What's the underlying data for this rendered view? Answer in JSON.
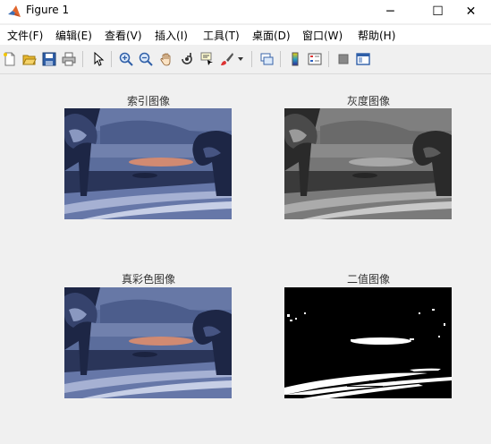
{
  "window": {
    "title": "Figure 1",
    "minimize_glyph": "─",
    "maximize_glyph": "☐",
    "close_glyph": "✕"
  },
  "menu": [
    {
      "label": "文件(F)"
    },
    {
      "label": "编辑(E)"
    },
    {
      "label": "查看(V)"
    },
    {
      "label": "插入(I)"
    },
    {
      "label": "工具(T)"
    },
    {
      "label": "桌面(D)"
    },
    {
      "label": "窗口(W)"
    },
    {
      "label": "帮助(H)"
    }
  ],
  "toolbar": {
    "icons": [
      "new-figure-icon",
      "open-file-icon",
      "save-icon",
      "print-icon",
      "pointer-icon",
      "zoom-in-icon",
      "zoom-out-icon",
      "pan-hand-icon",
      "rotate-3d-icon",
      "data-cursor-icon",
      "brush-icon",
      "link-plot-icon",
      "colorbar-icon",
      "legend-icon",
      "hide-plot-tools-icon",
      "show-plot-tools-icon"
    ]
  },
  "axes": [
    {
      "title": "索引图像",
      "variant": "color"
    },
    {
      "title": "灰度图像",
      "variant": "gray"
    },
    {
      "title": "真彩色图像",
      "variant": "color"
    },
    {
      "title": "二值图像",
      "variant": "binary"
    }
  ],
  "colors": {
    "sky_color": "#5b6d9c",
    "sunset": "#d18a72",
    "gray_sky": "#7a7a7a"
  }
}
